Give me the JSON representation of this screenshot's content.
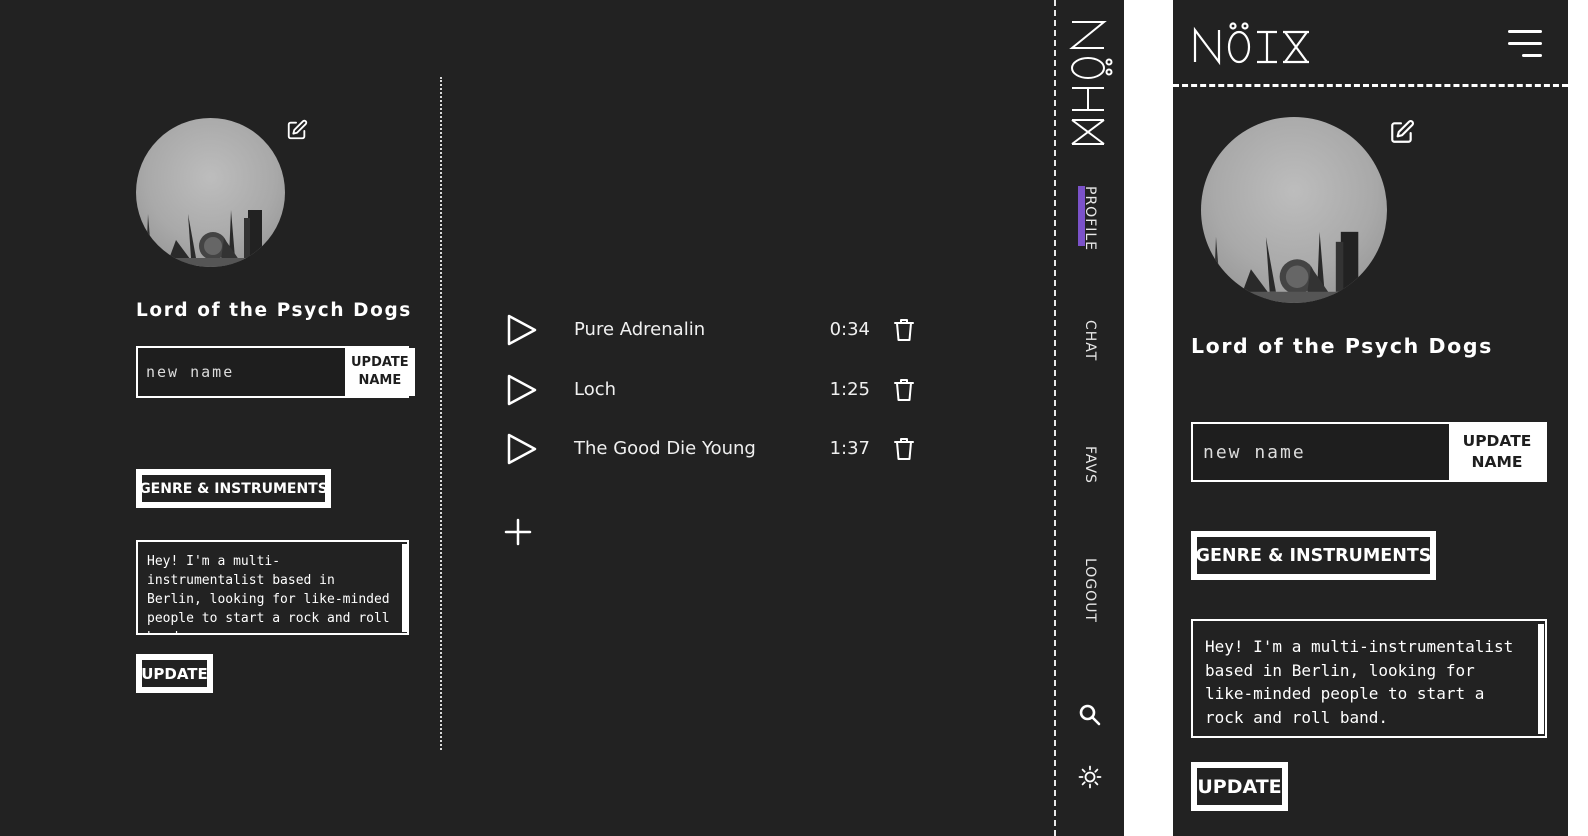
{
  "profile": {
    "display_name": "Lord of the Psych Dogs",
    "name_placeholder": "new name",
    "update_name_label": "UPDATE\nNAME",
    "genre_button_label": "GENRE & INSTRUMENTS",
    "bio_text": "Hey! I'm a multi-instrumentalist based in Berlin, looking for like-minded people to start a rock and roll band.",
    "update_label": "UPDATE"
  },
  "tracks": [
    {
      "title": "Pure Adrenalin",
      "duration": "0:34"
    },
    {
      "title": "Loch",
      "duration": "1:25"
    },
    {
      "title": "The Good Die Young",
      "duration": "1:37"
    }
  ],
  "nav": {
    "brand": "NÖIX",
    "items": [
      {
        "label": "PROFILE",
        "active": true
      },
      {
        "label": "CHAT",
        "active": false
      },
      {
        "label": "FAVS",
        "active": false
      },
      {
        "label": "LOGOUT",
        "active": false
      }
    ],
    "active_color": "#7b52c9"
  },
  "icons": {
    "edit": "pencil-square-icon",
    "play": "play-outline-icon",
    "delete": "trash-icon",
    "add": "plus-icon",
    "search": "search-icon",
    "theme": "sun-icon",
    "menu": "hamburger-icon"
  },
  "colors": {
    "background": "#222222",
    "foreground": "#ffffff",
    "accent": "#7b52c9"
  }
}
